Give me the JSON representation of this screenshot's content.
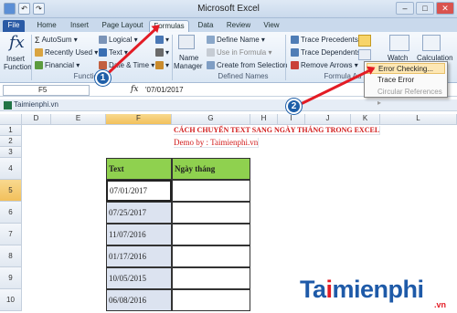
{
  "window": {
    "title": "Microsoft Excel"
  },
  "qat": {
    "icons": [
      "save-icon",
      "undo-icon",
      "redo-icon"
    ]
  },
  "tabs": [
    "File",
    "Home",
    "Insert",
    "Page Layout",
    "Formulas",
    "Data",
    "Review",
    "View"
  ],
  "active_tab": "Formulas",
  "ribbon": {
    "insert_function": {
      "line1": "Insert",
      "line2": "Function"
    },
    "library": {
      "autosum": "AutoSum",
      "recently_used": "Recently Used",
      "financial": "Financial",
      "logical": "Logical",
      "text": "Text",
      "date_time": "Date & Time",
      "label": "Function"
    },
    "names": {
      "name_manager_1": "Name",
      "name_manager_2": "Manager",
      "define_name": "Define Name",
      "use_in_formula": "Use in Formula",
      "create_from_selection": "Create from Selection",
      "label": "Defined Names"
    },
    "auditing": {
      "trace_precedents": "Trace Precedents",
      "trace_dependents": "Trace Dependents",
      "remove_arrows": "Remove Arrows",
      "label": "Formula Au"
    },
    "extra": {
      "watch": "Watch",
      "calculation": "Calculation"
    }
  },
  "dropdown": {
    "items": [
      "Error Checking...",
      "Trace Error",
      "Circular References"
    ]
  },
  "formula_bar": {
    "name_box": "F5",
    "fx": "fx",
    "value": "'07/01/2017"
  },
  "workbook": {
    "name": "Taimienphi.vn"
  },
  "columns": [
    "D",
    "E",
    "F",
    "G",
    "H",
    "I",
    "J",
    "K",
    "L"
  ],
  "rows": [
    "1",
    "2",
    "3",
    "4",
    "5",
    "6",
    "7",
    "8",
    "9",
    "10"
  ],
  "sheet": {
    "title": "CÁCH CHUYỂN TEXT SANG NGÀY THÁNG TRONG EXCEL",
    "demo": "Demo by : Taimienphi.vn",
    "header_text": "Text",
    "header_date": "Ngày tháng",
    "values": [
      "07/01/2017",
      "07/25/2017",
      "11/07/2016",
      "01/17/2016",
      "10/05/2015",
      "06/08/2016"
    ]
  },
  "badges": [
    "1",
    "2"
  ],
  "watermark": {
    "main_a": "Ta",
    "main_i": "i",
    "main_b": "mienphi",
    "sub": ".vn"
  }
}
